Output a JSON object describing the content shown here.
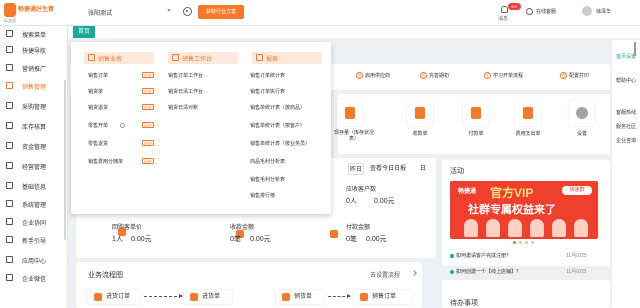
{
  "header": {
    "logo_text": "畅捷通好生意",
    "logo_sub": "标准版",
    "company": "张阳测试",
    "trial_button": "获取行业方案",
    "message_label": "消息",
    "message_badge": "99+",
    "service_label": "在线客服",
    "username": "徐泽华"
  },
  "sidebar": {
    "items": [
      {
        "label": "搜索菜单",
        "icon": "search-icon"
      },
      {
        "label": "快捷导航",
        "icon": "compass-icon"
      },
      {
        "label": "营销推广",
        "icon": "megaphone-icon"
      },
      {
        "label": "销售管理",
        "icon": "cart-icon",
        "active": true
      },
      {
        "label": "采购管理",
        "icon": "box-icon"
      },
      {
        "label": "库存核算",
        "icon": "warehouse-icon"
      },
      {
        "label": "资金管理",
        "icon": "money-icon"
      },
      {
        "label": "经营管理",
        "icon": "chart-icon"
      },
      {
        "label": "基础信息",
        "icon": "info-icon"
      },
      {
        "label": "系统管理",
        "icon": "settings-icon"
      },
      {
        "label": "企业协同",
        "icon": "team-icon"
      },
      {
        "label": "新手引导",
        "icon": "guide-icon"
      },
      {
        "label": "应用中心",
        "icon": "apps-icon"
      },
      {
        "label": "企业微信",
        "icon": "wechat-icon"
      }
    ]
  },
  "tabs": {
    "home": "首页"
  },
  "steps": [
    {
      "num": "5",
      "label": "启用供应商"
    },
    {
      "num": "6",
      "label": "完善期初"
    },
    {
      "num": "7",
      "label": "学习开单流程"
    },
    {
      "num": "8",
      "label": "配置打印"
    }
  ],
  "quick_actions": [
    {
      "label": "现存量（库存状况表）",
      "icon": "inventory-icon"
    },
    {
      "label": "收款单",
      "icon": "receipt-icon"
    },
    {
      "label": "付款单",
      "icon": "payment-icon"
    },
    {
      "label": "费用支出单",
      "icon": "expense-icon"
    },
    {
      "label": "设置",
      "icon": "gear-icon"
    }
  ],
  "date_tabs": {
    "yesterday": "昨日",
    "today_day": "日",
    "today_report": "查看今日日报"
  },
  "stats": {
    "receivable_label": "应收客户数",
    "receivable_value": "0人",
    "receivable_amount": "0.00元",
    "repurchase_label": "回购客单价",
    "repurchase_value": "1人",
    "repurchase_amount": "0.00元",
    "collection_label": "收款金额",
    "collection_value": "0笔",
    "collection_amount": "0.00元",
    "payment_label": "付款金额",
    "payment_value": "0笔",
    "payment_amount": "0.00元"
  },
  "flow": {
    "title": "业务流程图",
    "setup": "去设置流程",
    "nodes": [
      "进货订单",
      "进货单",
      "销货单",
      "销售订单"
    ]
  },
  "activity": {
    "title": "活动",
    "banner_brand": "畅捷通",
    "banner_vip": "官方VIP",
    "banner_tag": "快速群",
    "banner_main": "社群专属权益来了",
    "news": [
      {
        "text": "如何邀请客户完成注册？",
        "date": "11月02日"
      },
      {
        "text": "如何创建一个【线上店铺】？",
        "date": "11月02日"
      }
    ]
  },
  "todo": {
    "title": "待办事项"
  },
  "float_bar": [
    {
      "label": "首页设置",
      "active": true
    },
    {
      "label": "帮助中心"
    },
    {
      "label": "客服热线"
    },
    {
      "label": "服务社区"
    },
    {
      "label": "企业咨询"
    }
  ],
  "dropdown": {
    "columns": [
      {
        "head": "销售业务",
        "items": [
          {
            "label": "销售订单",
            "history": true
          },
          {
            "label": "销货单",
            "history": true
          },
          {
            "label": "销货退货",
            "history": true
          },
          {
            "label": "零售开单",
            "history": true,
            "info": true
          },
          {
            "label": "零售退货",
            "history": true
          },
          {
            "label": "销售费用分摊单",
            "history": true
          }
        ]
      },
      {
        "head": "销售工作台",
        "items": [
          {
            "label": "销售订单工作台"
          },
          {
            "label": "销货日清工作台"
          },
          {
            "label": "销货日清对账"
          }
        ]
      },
      {
        "head": "报表",
        "items": [
          {
            "label": "销售订单统计表"
          },
          {
            "label": "销售订单执行表"
          },
          {
            "label": "销售单统计表（按商品）"
          },
          {
            "label": "销售单统计表（按客户）"
          },
          {
            "label": "销售单统计表（按业务员）"
          },
          {
            "label": "商品毛利分析表"
          },
          {
            "label": "销售毛利分析表"
          },
          {
            "label": "销售排行榜"
          }
        ]
      }
    ],
    "history_tag": "历史"
  }
}
